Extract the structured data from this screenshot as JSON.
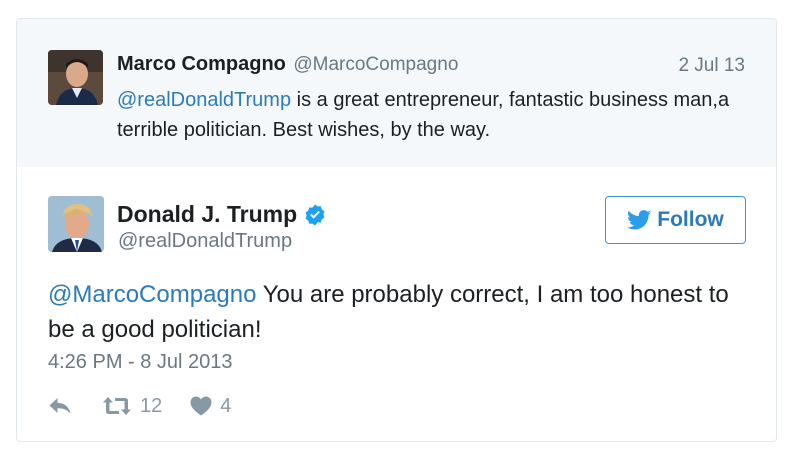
{
  "parent_tweet": {
    "author_name": "Marco Compagno",
    "author_handle": "@MarcoCompagno",
    "date": "2 Jul 13",
    "mention": "@realDonaldTrump",
    "text": " is a great entrepreneur, fantastic business man,a terrible politician. Best wishes, by the way."
  },
  "tweet": {
    "author_name": "Donald J. Trump",
    "author_handle": "@realDonaldTrump",
    "verified_icon": "verified-badge",
    "follow_label": "Follow",
    "mention": "@MarcoCompagno",
    "text": " You are probably correct, I am too honest to be a good politician!",
    "timestamp": "4:26 PM - 8 Jul 2013",
    "retweets": "12",
    "likes": "4"
  },
  "colors": {
    "link": "#2b7bb9",
    "muted": "#697882",
    "verified": "#1da1f2",
    "parent_bg": "#f5f8fa"
  }
}
